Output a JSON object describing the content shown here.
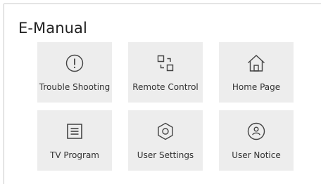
{
  "title": "E-Manual",
  "tiles": [
    {
      "label": "Trouble Shooting",
      "icon": "exclamation-circle-icon"
    },
    {
      "label": "Remote Control",
      "icon": "remote-control-icon"
    },
    {
      "label": "Home Page",
      "icon": "home-icon"
    },
    {
      "label": "TV Program",
      "icon": "list-icon"
    },
    {
      "label": "User Settings",
      "icon": "settings-hexagon-icon"
    },
    {
      "label": "User Notice",
      "icon": "user-notice-icon"
    }
  ],
  "colors": {
    "tile_bg": "#ededed",
    "text": "#333333",
    "icon": "#444444"
  }
}
